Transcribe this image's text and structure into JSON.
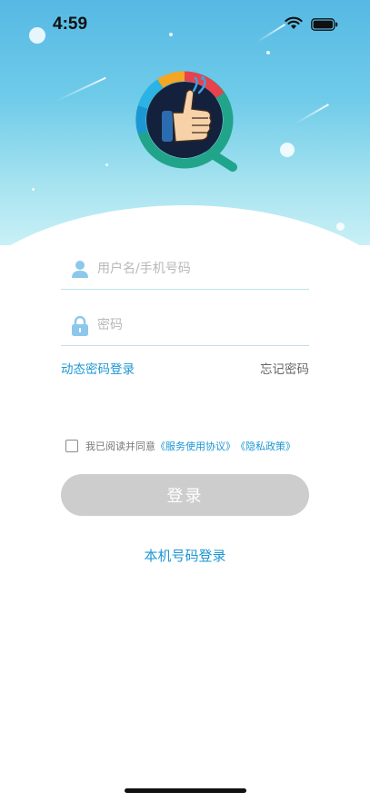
{
  "status_bar": {
    "time": "4:59"
  },
  "login_form": {
    "username_placeholder": "用户名/手机号码",
    "password_placeholder": "密码",
    "dynamic_password_login": "动态密码登录",
    "forgot_password": "忘记密码",
    "agreement_prefix": "我已阅读并同意",
    "service_agreement": "《服务使用协议》",
    "privacy_policy": "《隐私政策》",
    "login_button": "登录",
    "local_number_login": "本机号码登录"
  },
  "icons": {
    "user": "user-icon",
    "lock": "lock-icon",
    "logo": "thumbs-up-magnifier-logo",
    "wifi": "wifi-icon",
    "battery": "battery-icon"
  },
  "colors": {
    "accent": "#1c97d4",
    "button_disabled": "#cdcdcd",
    "field_icon": "#8cc8ec"
  }
}
